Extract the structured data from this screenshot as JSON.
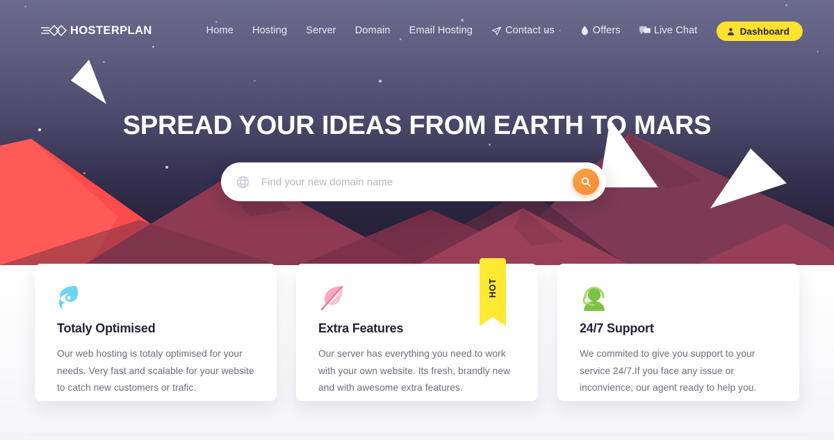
{
  "brand": {
    "name": "HOSTERPLAN",
    "logo_icon": "lines-diamonds-logo-icon"
  },
  "nav": {
    "items": [
      {
        "label": "Home",
        "icon": null
      },
      {
        "label": "Hosting",
        "icon": null
      },
      {
        "label": "Server",
        "icon": null
      },
      {
        "label": "Domain",
        "icon": null
      },
      {
        "label": "Email Hosting",
        "icon": null
      },
      {
        "label": "Contact us",
        "icon": "paper-plane-icon",
        "caret": "·"
      },
      {
        "label": "Offers",
        "icon": "flame-icon"
      },
      {
        "label": "Live Chat",
        "icon": "chat-bubble-icon"
      }
    ],
    "dashboard_button": {
      "label": "Dashboard",
      "icon": "user-icon",
      "bg_color": "#FFE12E",
      "text_color": "#26243A"
    }
  },
  "hero": {
    "title": "SPREAD YOUR IDEAS FROM EARTH TO MARS",
    "search": {
      "placeholder": "Find your new domain name",
      "value": "",
      "left_icon": "globe-icon",
      "button_icon": "search-icon",
      "button_color": "#F58B33"
    },
    "sky_color": "#5E5C80",
    "mountain_red": "#FC4B4B",
    "mountain_maroon": "#8E3A52",
    "snow_color": "#FFFFFF"
  },
  "cards": [
    {
      "icon": "hurricane-icon",
      "icon_color": "#6FD3F2",
      "title": "Totaly Optimised",
      "text": "Our web hosting is totaly optimised for your needs. Very fast and scalable for your website to catch new customers or trafic.",
      "badge": null
    },
    {
      "icon": "feather-icon",
      "icon_color": "#F9A8C0",
      "title": "Extra Features",
      "text": "Our server has everything you need to work with your own website. Its fresh, brandly new and with awesome extra features.",
      "badge": {
        "label": "HOT",
        "color": "#FFE933"
      }
    },
    {
      "icon": "support-agent-icon",
      "icon_color": "#7CC243",
      "title": "24/7 Support",
      "text": "We commited to give you support to your service 24/7.If you face any issue or inconvience; our agent ready to help you.",
      "badge": null
    }
  ]
}
